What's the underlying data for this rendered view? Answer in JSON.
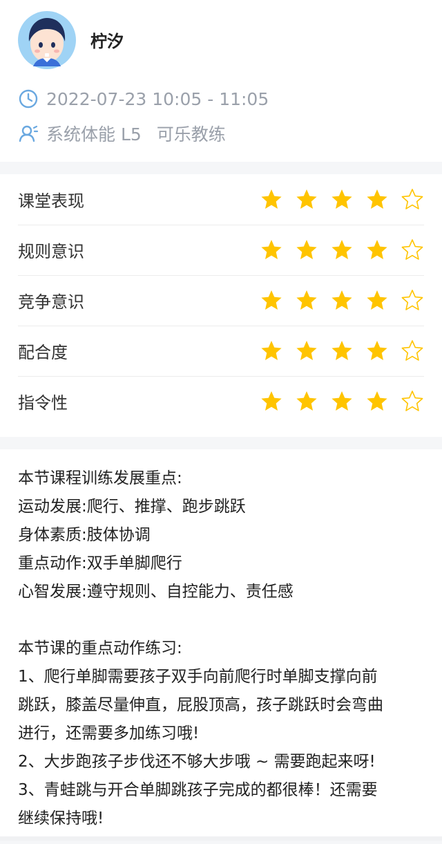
{
  "profile": {
    "name": "柠汐",
    "time_range": "2022-07-23 10:05 - 11:05",
    "course": "系统体能 L5",
    "coach": "可乐教练",
    "icons": {
      "time": "clock-icon",
      "coach": "user-icon"
    }
  },
  "colors": {
    "star_filled": "#FFC400",
    "star_empty": "#FFC400",
    "meta_icon": "#6aa8e0",
    "background": "#f5f6f8"
  },
  "ratings": [
    {
      "label": "课堂表现",
      "score": 4,
      "max": 5
    },
    {
      "label": "规则意识",
      "score": 4,
      "max": 5
    },
    {
      "label": "竞争意识",
      "score": 4,
      "max": 5
    },
    {
      "label": "配合度",
      "score": 4,
      "max": 5
    },
    {
      "label": "指令性",
      "score": 4,
      "max": 5
    }
  ],
  "notes": {
    "focus_title": "本节课程训练发展重点:",
    "focus_items": [
      "运动发展:爬行、推撑、跑步跳跃",
      "身体素质:肢体协调",
      "重点动作:双手单脚爬行",
      "心智发展:遵守规则、自控能力、责任感"
    ],
    "practice_title": "本节课的重点动作练习:",
    "practice_lines": [
      "1、爬行单脚需要孩子双手向前爬行时单脚支撑向前",
      "跳跃，膝盖尽量伸直，屁股顶高，孩子跳跃时会弯曲",
      "进行，还需要多加练习哦!",
      "2、大步跑孩子步伐还不够大步哦 ~ 需要跑起来呀!",
      "3、青蛙跳与开合单脚跳孩子完成的都很棒！还需要",
      "继续保持哦!"
    ]
  }
}
